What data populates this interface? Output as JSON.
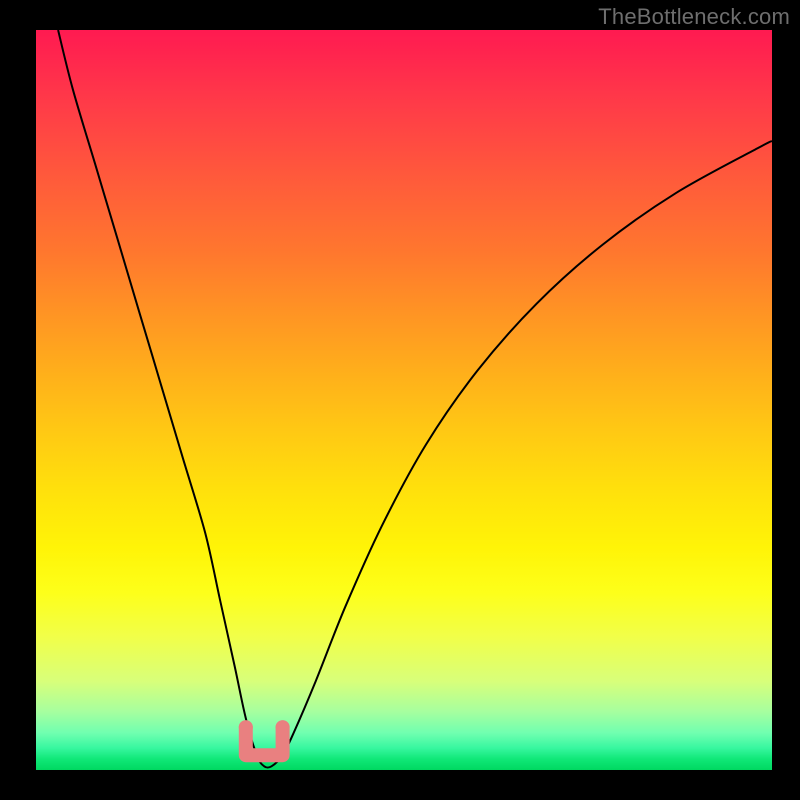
{
  "watermark": "TheBottleneck.com",
  "chart_data": {
    "type": "line",
    "title": "",
    "xlabel": "",
    "ylabel": "",
    "xlim": [
      0,
      100
    ],
    "ylim": [
      0,
      100
    ],
    "grid": false,
    "series": [
      {
        "name": "bottleneck-curve",
        "x": [
          3,
          5,
          8,
          11,
          14,
          17,
          20,
          23,
          25,
          27,
          28.5,
          30,
          31,
          32,
          33.5,
          35,
          38,
          42,
          47,
          53,
          60,
          68,
          77,
          87,
          98,
          100
        ],
        "y": [
          100,
          92,
          82,
          72,
          62,
          52,
          42,
          32,
          23,
          14,
          7,
          2,
          0.5,
          0.5,
          2,
          5,
          12,
          22,
          33,
          44,
          54,
          63,
          71,
          78,
          84,
          85
        ]
      }
    ],
    "annotations": [
      {
        "name": "valley-marker",
        "shape": "u-bracket",
        "color": "#e98080",
        "x_range": [
          28.5,
          33.5
        ],
        "y_level": 2
      }
    ]
  }
}
